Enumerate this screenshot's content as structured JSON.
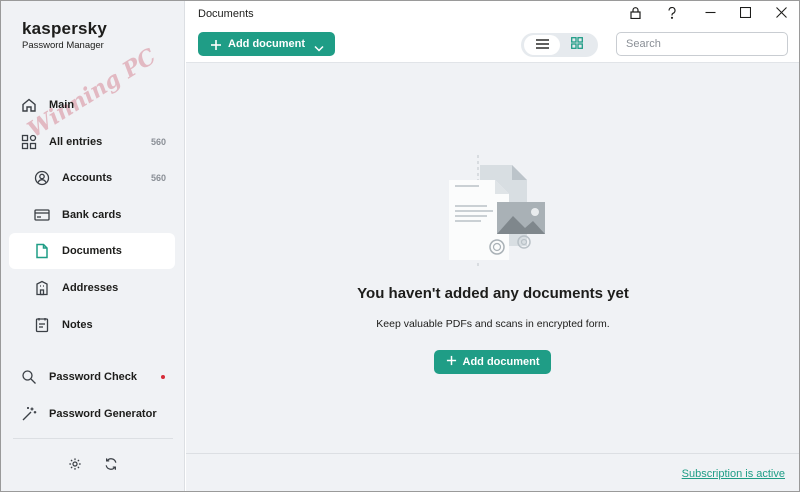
{
  "app": {
    "logo_main": "kaspersky",
    "logo_sub": "Password Manager",
    "watermark": "Winning PC"
  },
  "sidebar": {
    "items": [
      {
        "label": "Main",
        "icon": "home-icon"
      },
      {
        "label": "All entries",
        "icon": "grid-icon",
        "count": "560"
      },
      {
        "label": "Accounts",
        "icon": "user-circle-icon",
        "count": "560"
      },
      {
        "label": "Bank cards",
        "icon": "card-icon"
      },
      {
        "label": "Documents",
        "icon": "document-icon"
      },
      {
        "label": "Addresses",
        "icon": "building-icon"
      },
      {
        "label": "Notes",
        "icon": "note-icon"
      },
      {
        "label": "Password Check",
        "icon": "password-check-icon"
      },
      {
        "label": "Password Generator",
        "icon": "magic-wand-icon"
      }
    ],
    "bottom": {
      "settings_icon": "gear-icon",
      "sync_icon": "sync-icon"
    }
  },
  "header": {
    "title": "Documents",
    "add_label": "Add document",
    "search_placeholder": "Search",
    "window_controls": [
      "lock-icon",
      "help-icon",
      "minimize-icon",
      "maximize-icon",
      "close-icon"
    ]
  },
  "empty_state": {
    "title": "You haven't added any documents yet",
    "subtitle": "Keep valuable PDFs and scans in encrypted form.",
    "button_label": "Add document"
  },
  "footer": {
    "subscription": "Subscription is active"
  },
  "colors": {
    "accent": "#1f9d86",
    "sidebar_bg": "#f0f2f5",
    "alert_dot": "#d62b38"
  }
}
